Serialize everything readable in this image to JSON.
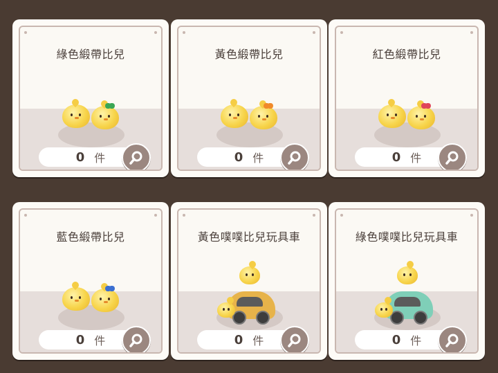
{
  "items": [
    {
      "name": "綠色緞帶比兒",
      "count": "0",
      "unit": "件",
      "kind": "chicks",
      "accent": "#3aa655"
    },
    {
      "name": "黃色緞帶比兒",
      "count": "0",
      "unit": "件",
      "kind": "chicks",
      "accent": "#f08a2a"
    },
    {
      "name": "紅色緞帶比兒",
      "count": "0",
      "unit": "件",
      "kind": "chicks",
      "accent": "#e0455a"
    },
    {
      "name": "藍色緞帶比兒",
      "count": "0",
      "unit": "件",
      "kind": "chicks",
      "accent": "#3b6fd1"
    },
    {
      "name": "黃色噗噗比兒玩具車",
      "count": "0",
      "unit": "件",
      "kind": "car",
      "accent": "#e7b34a"
    },
    {
      "name": "綠色噗噗比兒玩具車",
      "count": "0",
      "unit": "件",
      "kind": "car",
      "accent": "#7fcfb8"
    }
  ],
  "icons": {
    "search": "magnifier-icon"
  }
}
